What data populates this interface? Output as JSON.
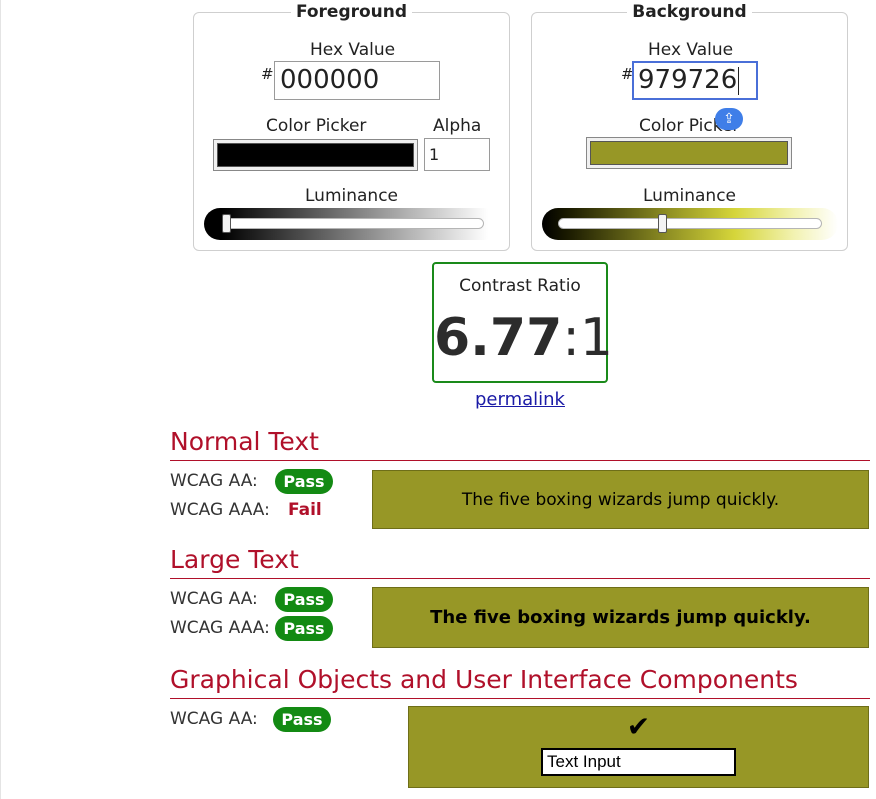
{
  "foreground": {
    "legend": "Foreground",
    "hex_label": "Hex Value",
    "hash": "#",
    "hex_value": "000000",
    "picker_label": "Color Picker",
    "alpha_label": "Alpha",
    "alpha_value": "1",
    "luminance_label": "Luminance",
    "swatch_color": "#000000",
    "luminance_level": 0.0
  },
  "background": {
    "legend": "Background",
    "hex_label": "Hex Value",
    "hash": "#",
    "hex_value": "979726",
    "picker_label": "Color Picker",
    "luminance_label": "Luminance",
    "swatch_color": "#979726",
    "luminance_level": 0.38
  },
  "contrast": {
    "label": "Contrast Ratio",
    "value_main": "6.77",
    "value_sep": ":",
    "value_one": "1",
    "permalink": "permalink"
  },
  "sections": {
    "normal": {
      "title": "Normal Text",
      "aa_label": "WCAG AA:",
      "aa_result": "Pass",
      "aaa_label": "WCAG AAA:",
      "aaa_result": "Fail",
      "sample": "The five boxing wizards jump quickly."
    },
    "large": {
      "title": "Large Text",
      "aa_label": "WCAG AA:",
      "aa_result": "Pass",
      "aaa_label": "WCAG AAA:",
      "aaa_result": "Pass",
      "sample": "The five boxing wizards jump quickly."
    },
    "graphical": {
      "title": "Graphical Objects and User Interface Components",
      "aa_label": "WCAG AA:",
      "aa_result": "Pass",
      "check": "✔",
      "input_value": "Text Input"
    }
  },
  "colors": {
    "pass": "#138a13",
    "fail": "#b0102a",
    "accent": "#b0102a",
    "focus": "#4a6fd8"
  }
}
